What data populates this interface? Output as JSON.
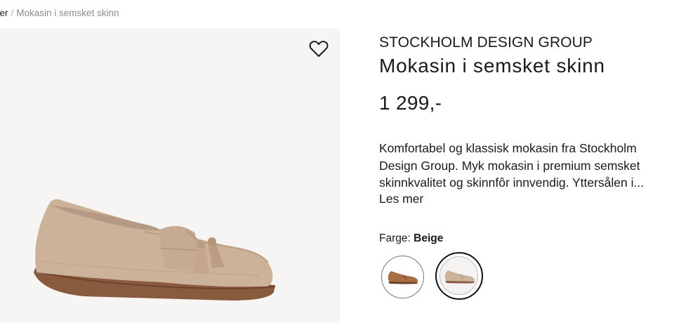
{
  "breadcrumb": {
    "previous": "ner",
    "separator": "/",
    "current": "Mokasin i semsket skinn"
  },
  "product": {
    "brand": "STOCKHOLM DESIGN GROUP",
    "title": "Mokasin i semsket skinn",
    "price": "1 299,-",
    "description": "Komfortabel og klassisk mokasin fra Stockholm Design Group. Myk mokasin i premium semsket skinnkvalitet og skinnfôr innvendig. Yttersålen i...",
    "read_more": "Les mer",
    "color_label": "Farge:",
    "color_value": "Beige",
    "image_alt": "Beige semsket mokasin med dusker"
  },
  "swatches": [
    {
      "name": "Brun",
      "color": "#a86e45",
      "selected": false
    },
    {
      "name": "Beige",
      "color": "#cdb39c",
      "selected": true
    }
  ],
  "icons": {
    "wishlist": "heart-icon"
  },
  "colors": {
    "shoe_upper": "#cdb29a",
    "shoe_sole": "#8a5a3e",
    "image_bg": "#f7f5f3"
  }
}
